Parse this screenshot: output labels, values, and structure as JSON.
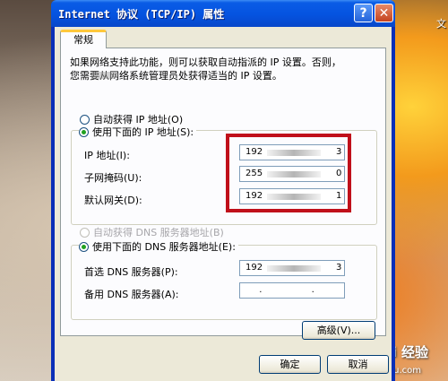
{
  "window": {
    "title": "Internet 协议 (TCP/IP) 属性",
    "help_label": "?",
    "close_label": "✕"
  },
  "desktop": {
    "corner_text": "文",
    "watermark": "Bai 经验",
    "watermark_sub": "jingyan.baidu.com"
  },
  "tab": {
    "label": "常规"
  },
  "intro": {
    "line1": "如果网络支持此功能，则可以获取自动指派的 IP 设置。否则，",
    "line2": "您需要从网络系统管理员处获得适当的 IP 设置。"
  },
  "ip_section": {
    "auto_label": "自动获得 IP 地址(O)",
    "manual_label": "使用下面的 IP 地址(S):",
    "ip_label": "IP 地址(I):",
    "ip_first": "192",
    "ip_last": "3",
    "subnet_label": "子网掩码(U):",
    "subnet_first": "255",
    "subnet_last": "0",
    "gateway_label": "默认网关(D):",
    "gateway_first": "192",
    "gateway_last": "1"
  },
  "dns_section": {
    "auto_label": "自动获得 DNS 服务器地址(B)",
    "manual_label": "使用下面的 DNS 服务器地址(E):",
    "preferred_label": "首选 DNS 服务器(P):",
    "preferred_first": "192",
    "preferred_last": "3",
    "alternate_label": "备用 DNS 服务器(A):",
    "alternate_dots": ". . ."
  },
  "buttons": {
    "advanced": "高级(V)...",
    "ok": "确定",
    "cancel": "取消"
  },
  "colors": {
    "title_bar": "#0553e0",
    "highlight": "#c0101a",
    "radio_dot": "#21a121"
  }
}
